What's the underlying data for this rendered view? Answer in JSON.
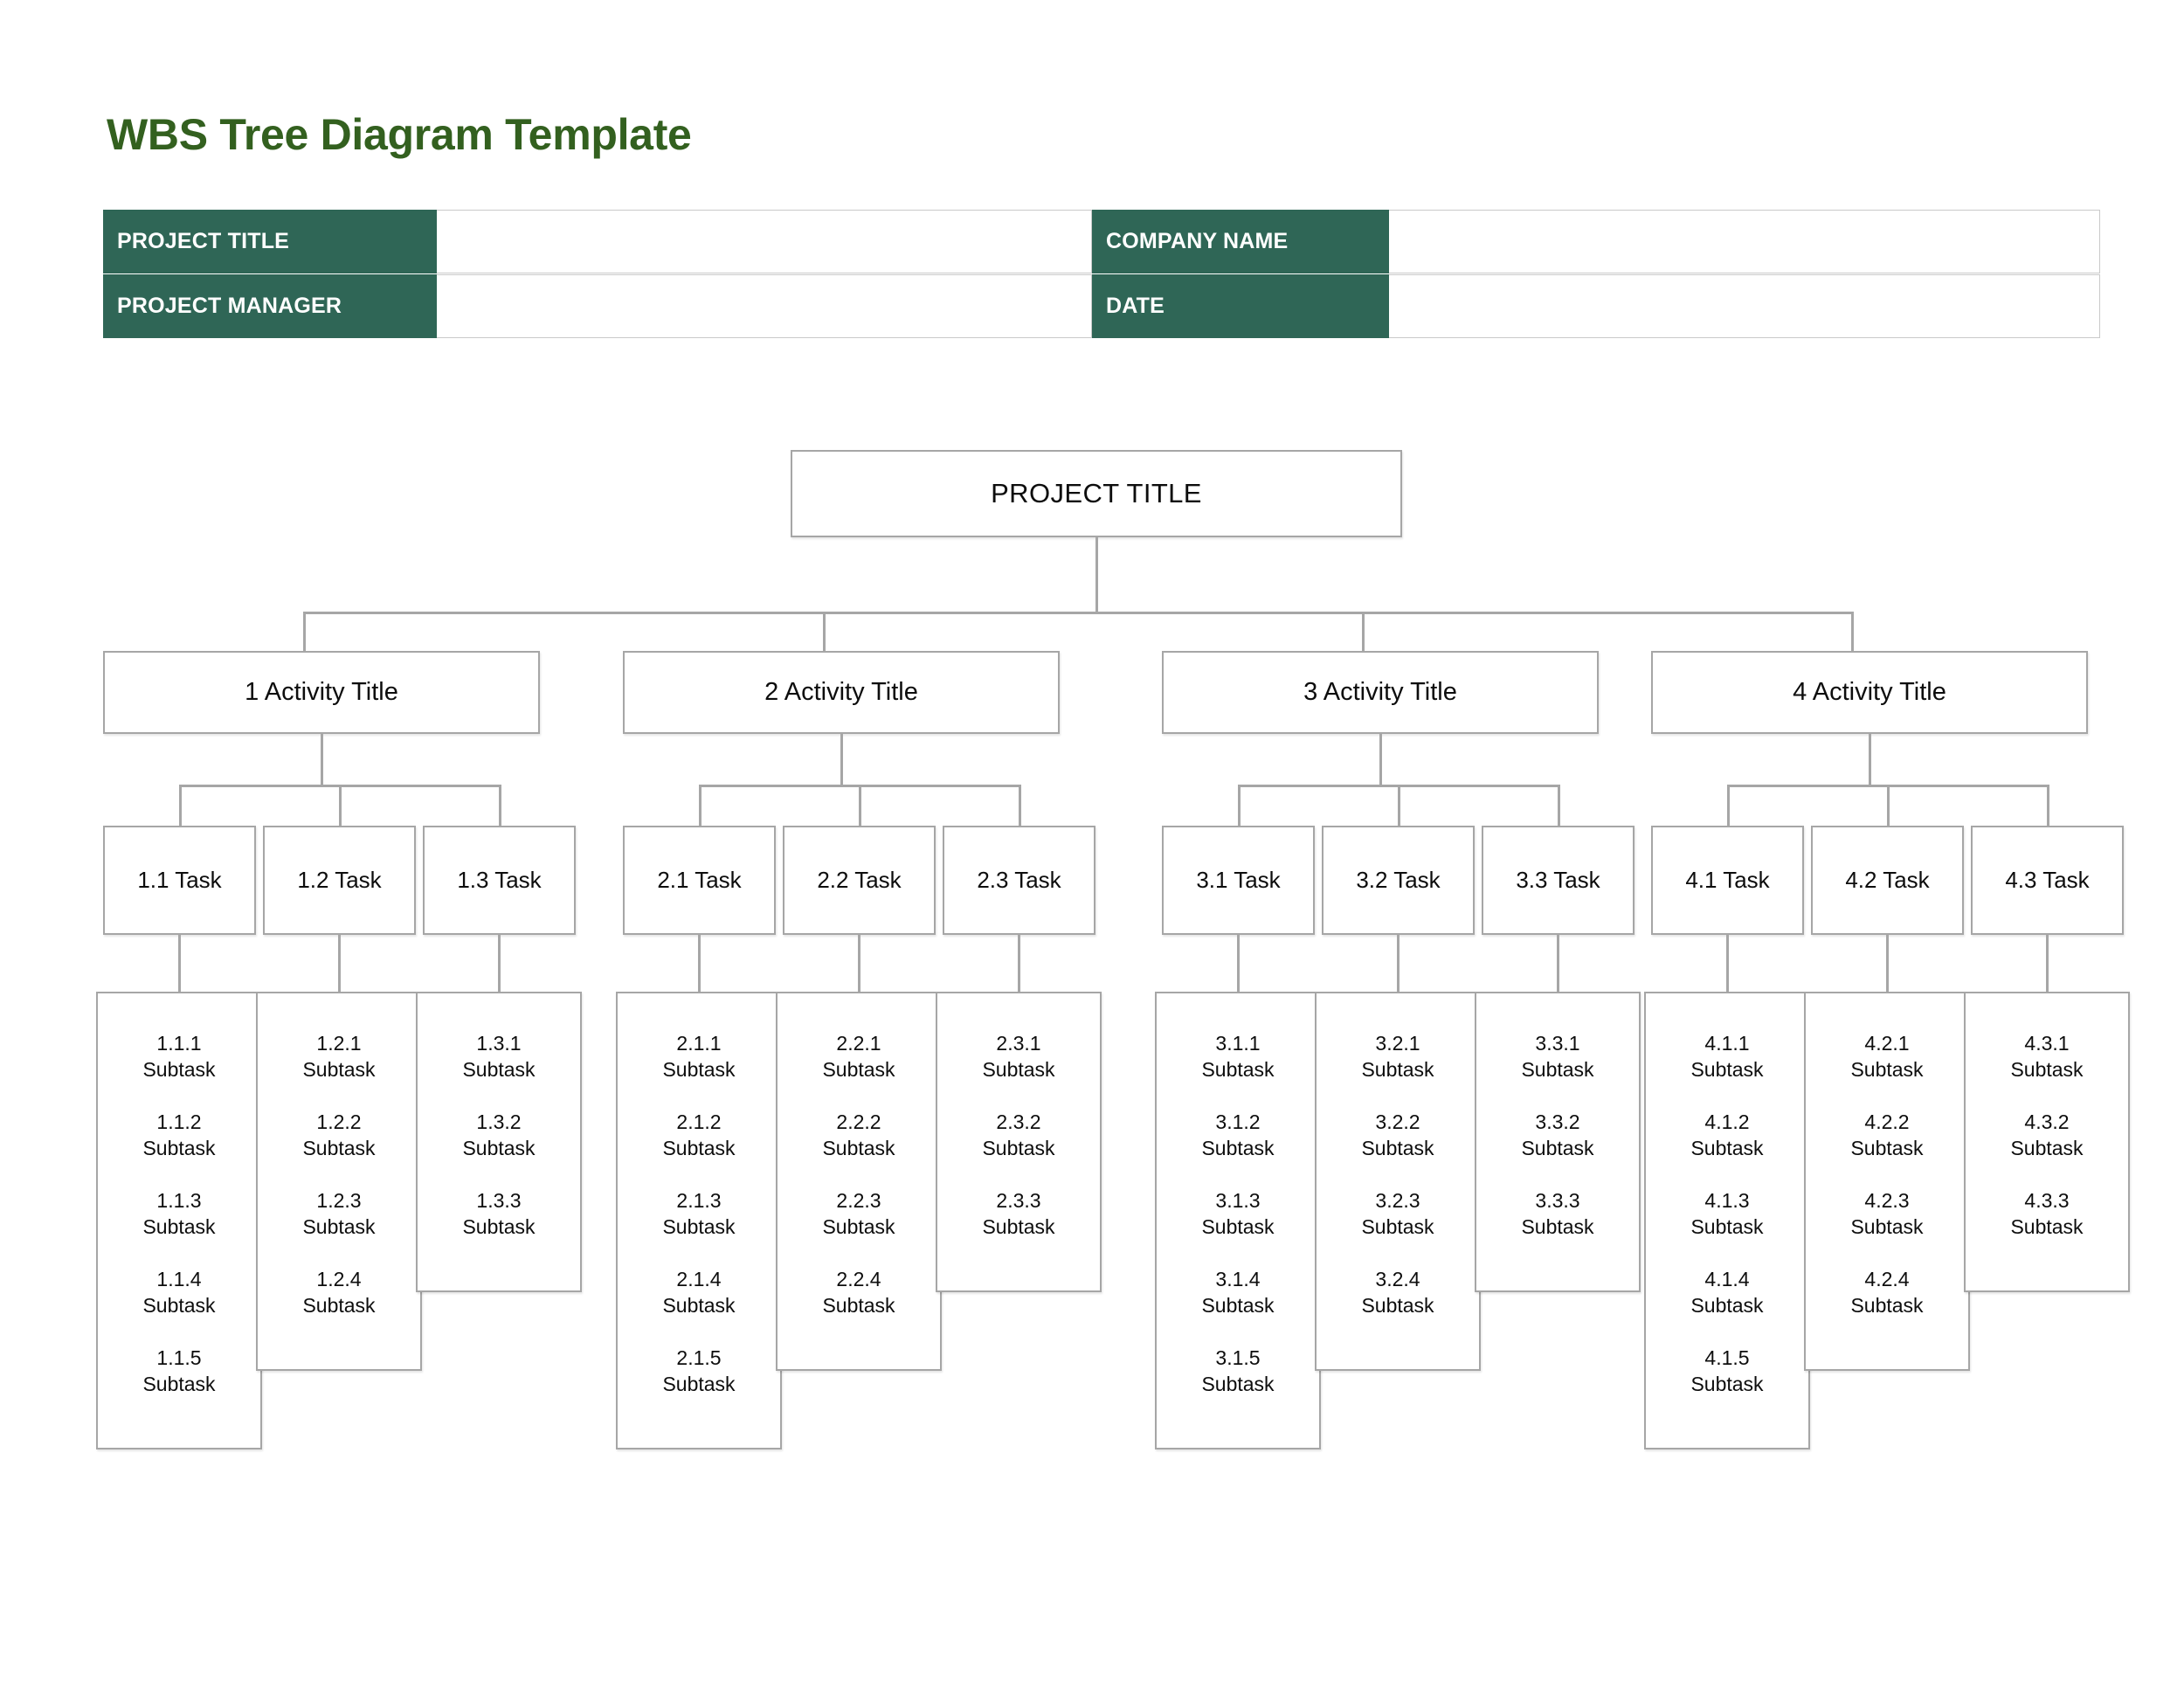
{
  "page": {
    "title": "WBS Tree Diagram Template"
  },
  "info_table": {
    "rows": [
      {
        "left_label": "PROJECT TITLE",
        "left_value": "",
        "right_label": "COMPANY NAME",
        "right_value": ""
      },
      {
        "left_label": "PROJECT MANAGER",
        "left_value": "",
        "right_label": "DATE",
        "right_value": ""
      }
    ]
  },
  "diagram": {
    "root": {
      "label": "PROJECT TITLE"
    },
    "groups": [
      {
        "activity": "1 Activity Title",
        "tasks": [
          {
            "label": "1.1 Task",
            "subtasks": [
              "1.1.1",
              "1.1.2",
              "1.1.3",
              "1.1.4",
              "1.1.5"
            ]
          },
          {
            "label": "1.2 Task",
            "subtasks": [
              "1.2.1",
              "1.2.2",
              "1.2.3",
              "1.2.4"
            ]
          },
          {
            "label": "1.3 Task",
            "subtasks": [
              "1.3.1",
              "1.3.2",
              "1.3.3"
            ]
          }
        ]
      },
      {
        "activity": "2 Activity Title",
        "tasks": [
          {
            "label": "2.1 Task",
            "subtasks": [
              "2.1.1",
              "2.1.2",
              "2.1.3",
              "2.1.4",
              "2.1.5"
            ]
          },
          {
            "label": "2.2 Task",
            "subtasks": [
              "2.2.1",
              "2.2.2",
              "2.2.3",
              "2.2.4"
            ]
          },
          {
            "label": "2.3 Task",
            "subtasks": [
              "2.3.1",
              "2.3.2",
              "2.3.3"
            ]
          }
        ]
      },
      {
        "activity": "3 Activity Title",
        "tasks": [
          {
            "label": "3.1 Task",
            "subtasks": [
              "3.1.1",
              "3.1.2",
              "3.1.3",
              "3.1.4",
              "3.1.5"
            ]
          },
          {
            "label": "3.2 Task",
            "subtasks": [
              "3.2.1",
              "3.2.2",
              "3.2.3",
              "3.2.4"
            ]
          },
          {
            "label": "3.3 Task",
            "subtasks": [
              "3.3.1",
              "3.3.2",
              "3.3.3"
            ]
          }
        ]
      },
      {
        "activity": "4 Activity Title",
        "tasks": [
          {
            "label": "4.1 Task",
            "subtasks": [
              "4.1.1",
              "4.1.2",
              "4.1.3",
              "4.1.4",
              "4.1.5"
            ]
          },
          {
            "label": "4.2 Task",
            "subtasks": [
              "4.2.1",
              "4.2.2",
              "4.2.3",
              "4.2.4"
            ]
          },
          {
            "label": "4.3 Task",
            "subtasks": [
              "4.3.1",
              "4.3.2",
              "4.3.3"
            ]
          }
        ]
      }
    ],
    "subtask_word": "Subtask"
  },
  "colors": {
    "title_green": "#33601f",
    "header_green": "#2f6656",
    "node_border": "#a6a6a6",
    "text": "#0d0d0d"
  }
}
